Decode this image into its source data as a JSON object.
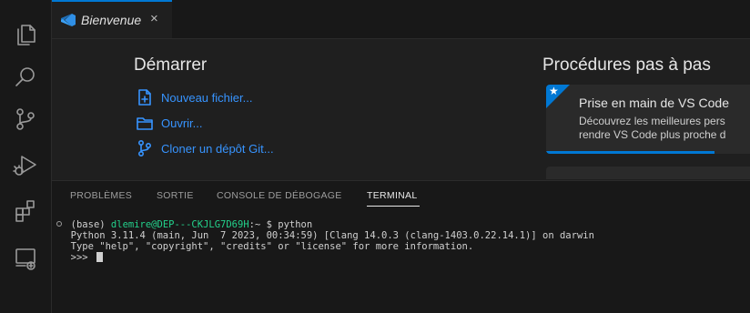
{
  "tab": {
    "label": "Bienvenue",
    "close": "×"
  },
  "welcome": {
    "start": {
      "title": "Démarrer",
      "items": [
        {
          "label": "Nouveau fichier...",
          "icon": "new-file-icon"
        },
        {
          "label": "Ouvrir...",
          "icon": "folder-icon"
        },
        {
          "label": "Cloner un dépôt Git...",
          "icon": "source-control-icon"
        }
      ]
    },
    "walkthroughs": {
      "title": "Procédures pas à pas",
      "card": {
        "title": "Prise en main de VS Code",
        "desc1": "Découvrez les meilleures pers",
        "desc2": "rendre VS Code plus proche d",
        "progress": 0.77
      }
    }
  },
  "panel": {
    "tabs": [
      "PROBLÈMES",
      "SORTIE",
      "CONSOLE DE DÉBOGAGE",
      "TERMINAL"
    ],
    "active_tab": "TERMINAL"
  },
  "terminal": {
    "prefix": "(base) ",
    "user_host": "dlemire@DEP---CKJLG7D69H",
    "prompt_rest": ":~ $ python",
    "line2": "Python 3.11.4 (main, Jun  7 2023, 00:34:59) [Clang 14.0.3 (clang-1403.0.22.14.1)] on darwin",
    "line3": "Type \"help\", \"copyright\", \"credits\" or \"license\" for more information.",
    "line4": ">>> "
  },
  "colors": {
    "accent": "#0078d4",
    "link": "#3794ff",
    "terminal_green": "#23d18b"
  }
}
